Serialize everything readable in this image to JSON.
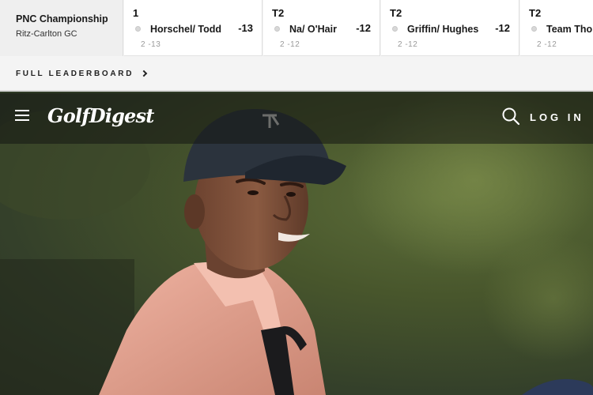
{
  "ticker": {
    "event": {
      "name": "PNC Championship",
      "course": "Ritz-Carlton GC"
    },
    "cards": [
      {
        "position": "1",
        "team": "Horschel/ Todd",
        "score": "-13",
        "detail": "2 -13"
      },
      {
        "position": "T2",
        "team": "Na/ O'Hair",
        "score": "-12",
        "detail": "2 -12"
      },
      {
        "position": "T2",
        "team": "Griffin/ Hughes",
        "score": "-12",
        "detail": "2 -12"
      },
      {
        "position": "T2",
        "team": "Team Thomas",
        "score": "",
        "detail": "2 -12"
      }
    ],
    "full_leaderboard_label": "FULL LEADERBOARD",
    "icons": {
      "chevron": "chevron-right-icon",
      "player": "player-dot-icon"
    }
  },
  "header": {
    "brand": "GolfDigest",
    "login_label": "LOG IN",
    "icons": {
      "menu": "hamburger-menu-icon",
      "search": "search-icon"
    }
  },
  "hero": {
    "image": "golfer-portrait-photo",
    "colors": {
      "shirt": "#e9a593",
      "cap": "#2b333d",
      "background": "#4a5a2e"
    }
  }
}
